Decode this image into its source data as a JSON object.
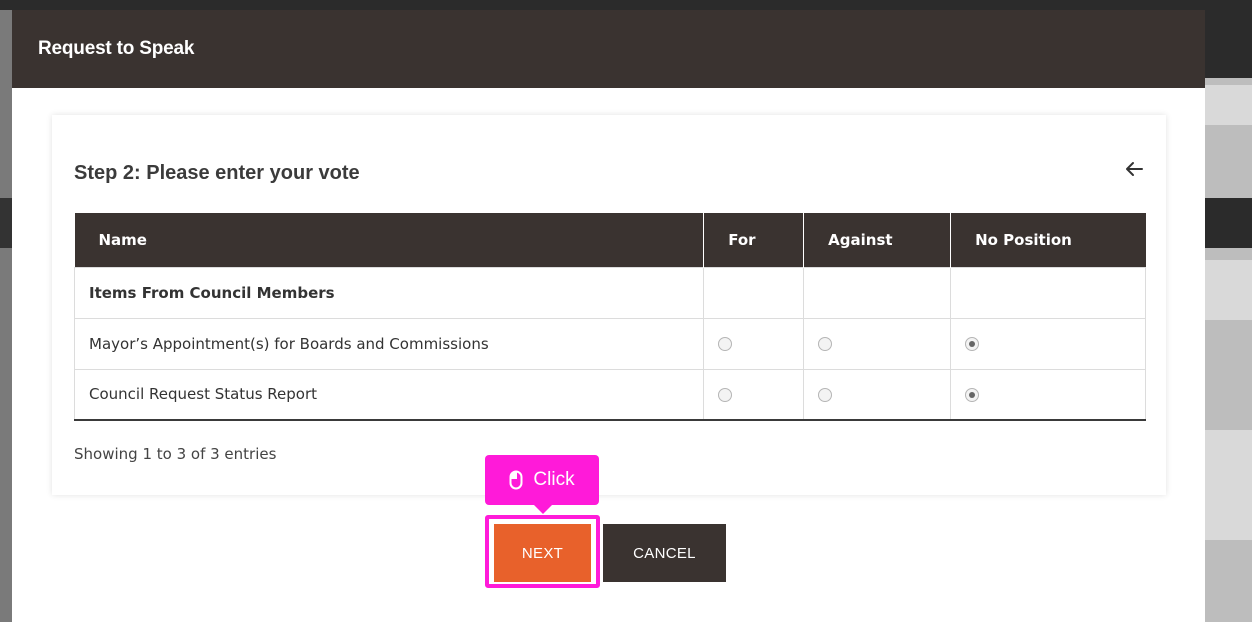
{
  "modal": {
    "title": "Request to Speak"
  },
  "step": {
    "title": "Step 2: Please enter your vote",
    "back_icon": "arrow-left-icon"
  },
  "table": {
    "columns": [
      "Name",
      "For",
      "Against",
      "No Position"
    ],
    "group": "Items From Council Members",
    "rows": [
      {
        "name": "Mayor’s Appointment(s) for Boards and Commissions",
        "selected": "No Position"
      },
      {
        "name": "Council Request Status Report",
        "selected": "No Position"
      }
    ]
  },
  "footer": {
    "showing": "Showing 1 to 3 of 3 entries"
  },
  "buttons": {
    "next": "NEXT",
    "cancel": "CANCEL"
  },
  "tooltip": {
    "label": "Click",
    "icon": "mouse-icon",
    "color": "#ff1ad9"
  },
  "colors": {
    "header_bg": "#3a3330",
    "next_bg": "#e8612b",
    "cancel_bg": "#3a3330"
  }
}
